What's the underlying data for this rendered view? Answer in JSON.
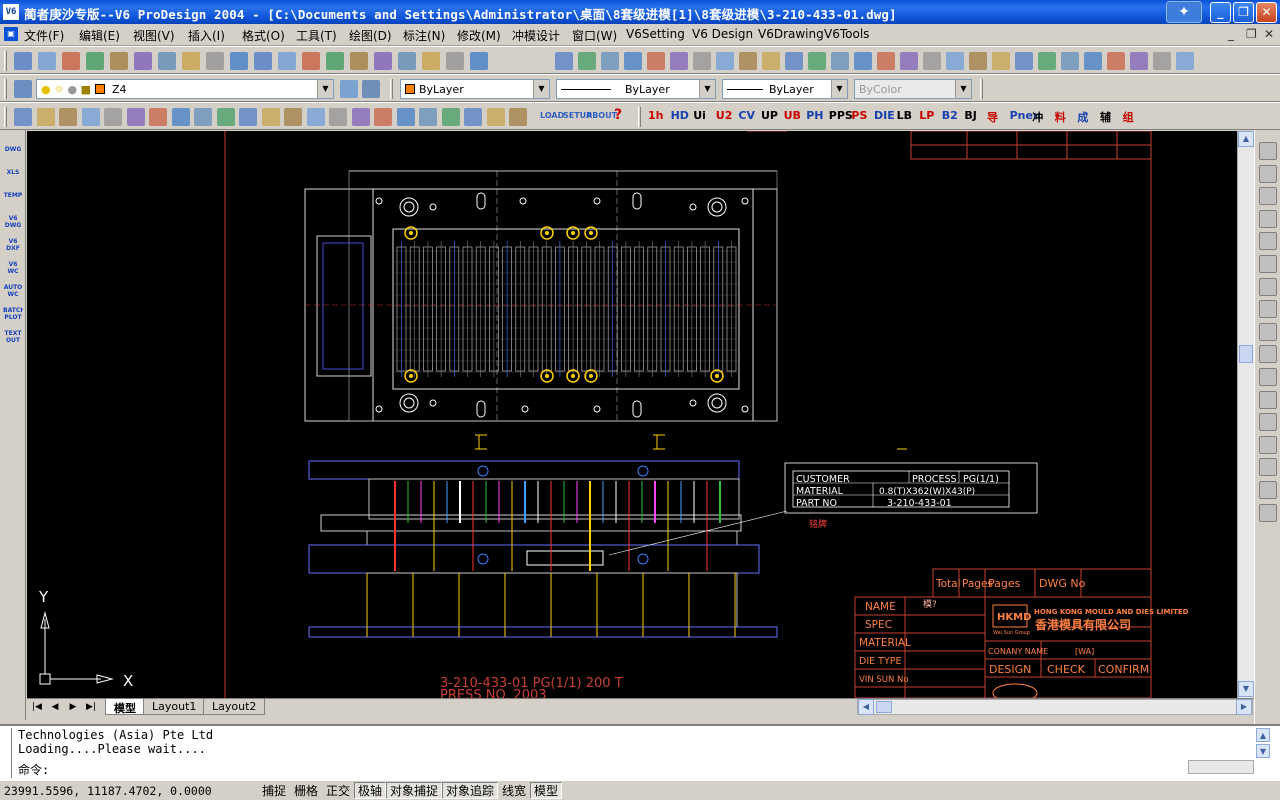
{
  "window": {
    "app_icon": "V6",
    "title": "蔺者庚沙专版--V6 ProDesign 2004 - [C:\\Documents and Settings\\Administrator\\桌面\\8套级进模[1]\\8套级进模\\3-210-433-01.dwg]"
  },
  "menu": [
    "文件(F)",
    "编辑(E)",
    "视图(V)",
    "插入(I)",
    "格式(O)",
    "工具(T)",
    "绘图(D)",
    "标注(N)",
    "修改(M)",
    "冲模设计",
    "窗口(W)",
    "V6Setting",
    "V6 Design",
    "V6Drawing",
    "V6Tools"
  ],
  "layers": {
    "current_layer": "Z4",
    "color": "ByLayer",
    "linetype": "ByLayer",
    "lineweight": "ByLayer",
    "plotstyle": "ByColor"
  },
  "toolbar3_text": [
    "LOAD",
    "SETUP",
    "ABOUT",
    "?"
  ],
  "toolbar3_labels": [
    "1h",
    "HD",
    "Ui",
    "U2",
    "CV",
    "UP",
    "UB",
    "PH",
    "PPS",
    "PS",
    "DIE",
    "LB",
    "LP",
    "B2",
    "BJ",
    "导",
    "Pneu",
    "冲",
    "料",
    "成",
    "辅",
    "组"
  ],
  "left_tools": [
    "DWG",
    "XLS",
    "TEMP",
    "V6 DWG",
    "V6 DXF",
    "V6 WC",
    "AUTO WC",
    "BATCH PLOT",
    "TEXT OUT"
  ],
  "drawing": {
    "name_table": {
      "customer_label": "CUSTOMER",
      "process_label": "PROCESS",
      "process_value": "PG(1/1)",
      "material_label": "MATERIAL",
      "material_value": "0.8(T)X362(W)X43(P)",
      "partno_label": "PART NO",
      "partno_value": "3-210-433-01"
    },
    "callout": "铭牌",
    "title_line1": "3-210-433-01 PG(1/1) 200 T",
    "title_line2": "PRESS NO. 2003",
    "title_block": {
      "total_label": "Total",
      "pages_label": "Pages",
      "pages2": "Pages",
      "dwg_no": "DWG No",
      "name_label": "NAME",
      "name_value": "模?",
      "spec_label": "SPEC",
      "material_label": "MATERIAL",
      "dietype_label": "DIE TYPE",
      "vinsun_label": "VIN SUN No",
      "company_label": "CONANY NAME",
      "company_value": "[WA]",
      "design_label": "DESIGN",
      "check_label": "CHECK",
      "confirm_label": "CONFIRM",
      "logo_text": "HKMD",
      "logo_sub": "Wai Sun Group",
      "company_en": "HONG KONG MOULD AND DIES LIMITED",
      "company_cn": "香港模具有限公司"
    },
    "ucs_x": "X",
    "ucs_y": "Y"
  },
  "tabs": [
    "模型",
    "Layout1",
    "Layout2"
  ],
  "command": {
    "line1": "Technologies (Asia) Pte Ltd",
    "line2": "Loading....Please wait....",
    "prompt": "命令:"
  },
  "status": {
    "coords": "23991.5596, 11187.4702, 0.0000",
    "toggles": [
      "捕捉",
      "栅格",
      "正交",
      "极轴",
      "对象捕捉",
      "对象追踪",
      "线宽",
      "模型"
    ]
  }
}
